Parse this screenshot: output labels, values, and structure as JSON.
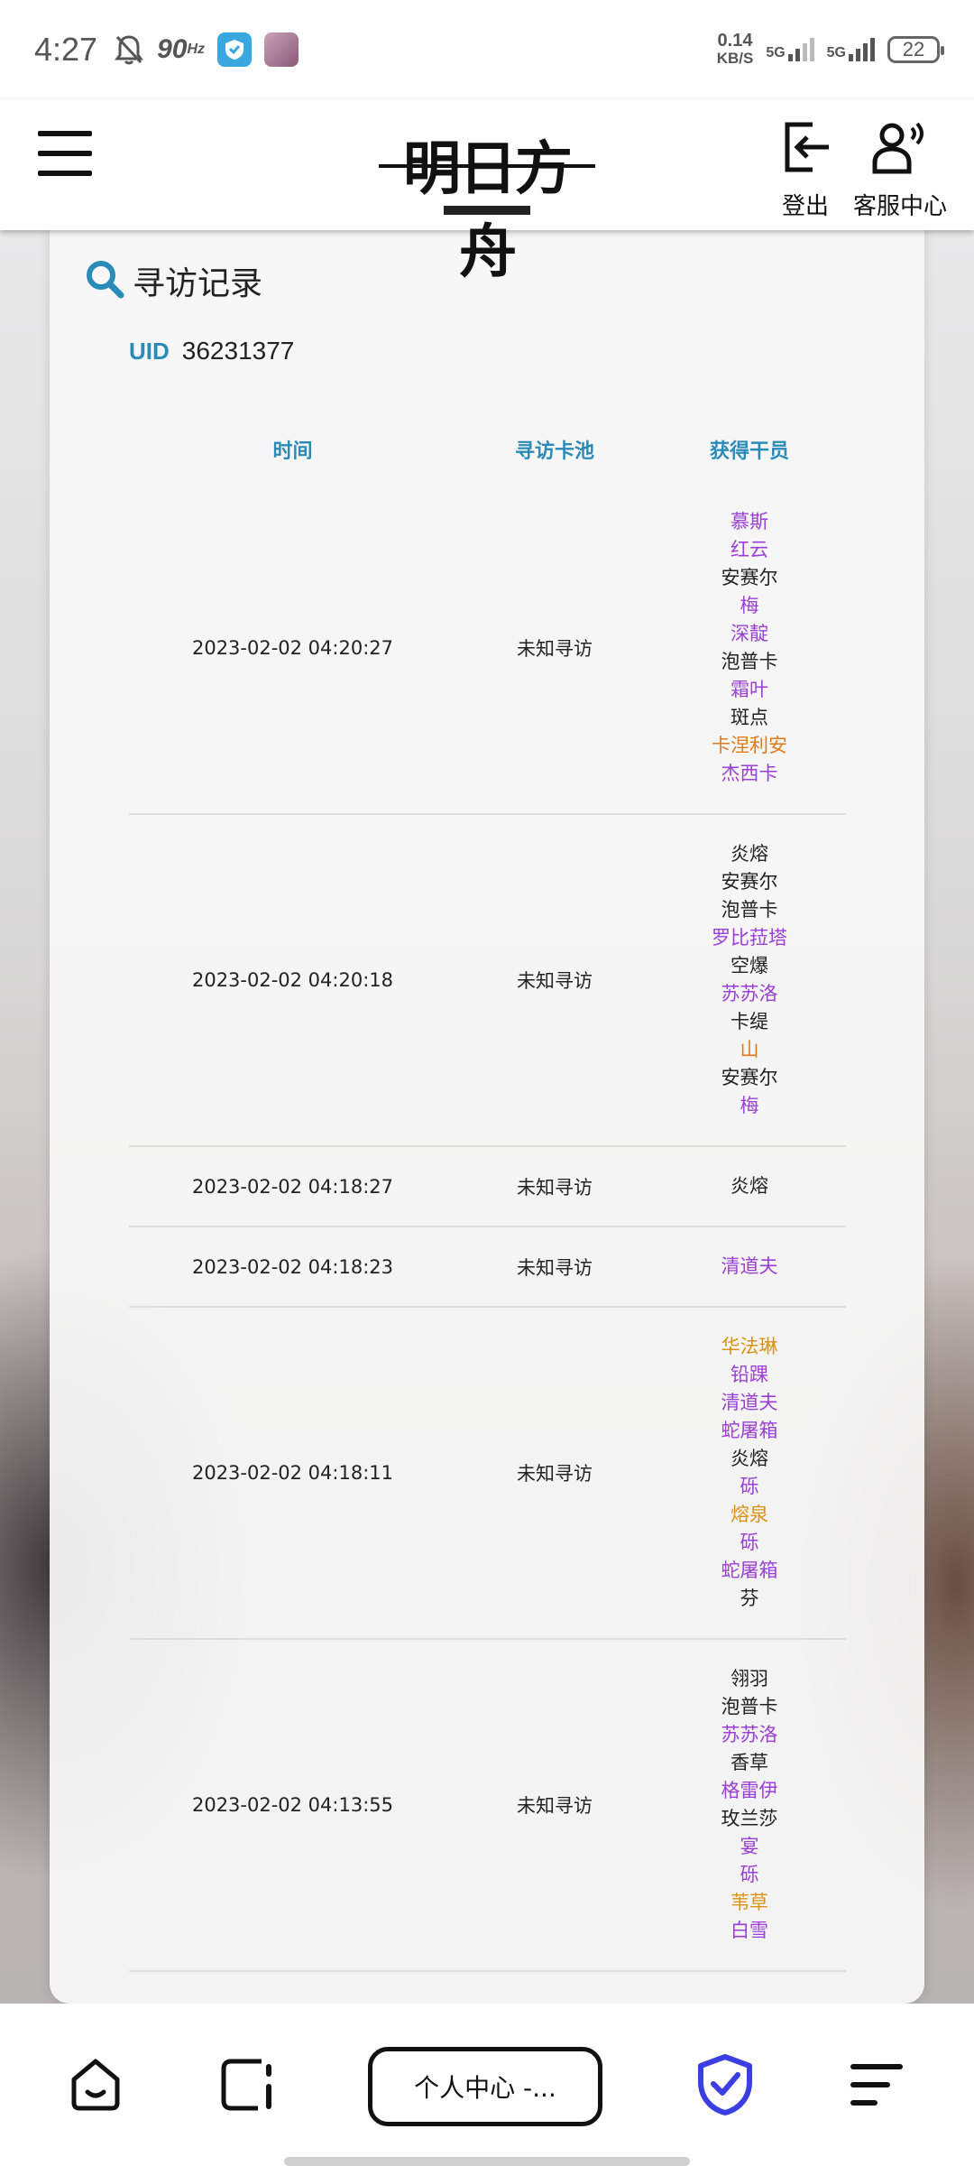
{
  "status_bar": {
    "time": "4:27",
    "refresh_rate": "90",
    "refresh_unit": "Hz",
    "net_speed_value": "0.14",
    "net_speed_unit": "KB/S",
    "signal1_label": "5G",
    "signal2_label": "5G",
    "battery": "22"
  },
  "header": {
    "logo_text": "明日方舟",
    "logout_label": "登出",
    "service_label": "客服中心"
  },
  "card": {
    "title": "寻访记录",
    "uid_label": "UID",
    "uid_value": "36231377"
  },
  "table": {
    "columns": [
      "时间",
      "寻访卡池",
      "获得干员"
    ],
    "rows": [
      {
        "time": "2023-02-02 04:20:27",
        "pool": "未知寻访",
        "operators": [
          {
            "name": "慕斯",
            "color": "#9b3fd6"
          },
          {
            "name": "红云",
            "color": "#9b3fd6"
          },
          {
            "name": "安赛尔",
            "color": "#222222"
          },
          {
            "name": "梅",
            "color": "#9b3fd6"
          },
          {
            "name": "深靛",
            "color": "#9b3fd6"
          },
          {
            "name": "泡普卡",
            "color": "#222222"
          },
          {
            "name": "霜叶",
            "color": "#9b3fd6"
          },
          {
            "name": "斑点",
            "color": "#222222"
          },
          {
            "name": "卡涅利安",
            "color": "#e07b1a"
          },
          {
            "name": "杰西卡",
            "color": "#9b3fd6"
          }
        ]
      },
      {
        "time": "2023-02-02 04:20:18",
        "pool": "未知寻访",
        "operators": [
          {
            "name": "炎熔",
            "color": "#222222"
          },
          {
            "name": "安赛尔",
            "color": "#222222"
          },
          {
            "name": "泡普卡",
            "color": "#222222"
          },
          {
            "name": "罗比菈塔",
            "color": "#9b3fd6"
          },
          {
            "name": "空爆",
            "color": "#222222"
          },
          {
            "name": "苏苏洛",
            "color": "#9b3fd6"
          },
          {
            "name": "卡缇",
            "color": "#222222"
          },
          {
            "name": "山",
            "color": "#e07b1a"
          },
          {
            "name": "安赛尔",
            "color": "#222222"
          },
          {
            "name": "梅",
            "color": "#9b3fd6"
          }
        ]
      },
      {
        "time": "2023-02-02 04:18:27",
        "pool": "未知寻访",
        "operators": [
          {
            "name": "炎熔",
            "color": "#222222"
          }
        ]
      },
      {
        "time": "2023-02-02 04:18:23",
        "pool": "未知寻访",
        "operators": [
          {
            "name": "清道夫",
            "color": "#9b3fd6"
          }
        ]
      },
      {
        "time": "2023-02-02 04:18:11",
        "pool": "未知寻访",
        "operators": [
          {
            "name": "华法琳",
            "color": "#d99215"
          },
          {
            "name": "铅踝",
            "color": "#9b3fd6"
          },
          {
            "name": "清道夫",
            "color": "#9b3fd6"
          },
          {
            "name": "蛇屠箱",
            "color": "#9b3fd6"
          },
          {
            "name": "炎熔",
            "color": "#222222"
          },
          {
            "name": "砾",
            "color": "#9b3fd6"
          },
          {
            "name": "熔泉",
            "color": "#d99215"
          },
          {
            "name": "砾",
            "color": "#9b3fd6"
          },
          {
            "name": "蛇屠箱",
            "color": "#9b3fd6"
          },
          {
            "name": "芬",
            "color": "#222222"
          }
        ]
      },
      {
        "time": "2023-02-02 04:13:55",
        "pool": "未知寻访",
        "operators": [
          {
            "name": "翎羽",
            "color": "#222222"
          },
          {
            "name": "泡普卡",
            "color": "#222222"
          },
          {
            "name": "苏苏洛",
            "color": "#9b3fd6"
          },
          {
            "name": "香草",
            "color": "#222222"
          },
          {
            "name": "格雷伊",
            "color": "#9b3fd6"
          },
          {
            "name": "玫兰莎",
            "color": "#222222"
          },
          {
            "name": "宴",
            "color": "#9b3fd6"
          },
          {
            "name": "砾",
            "color": "#9b3fd6"
          },
          {
            "name": "苇草",
            "color": "#d99215"
          },
          {
            "name": "白雪",
            "color": "#9b3fd6"
          }
        ]
      }
    ]
  },
  "bottom_bar": {
    "tab_label": "个人中心 -...",
    "icons": [
      "home-icon",
      "tabs-icon",
      "shield-check-icon",
      "menu-icon"
    ],
    "shield_color": "#3b3ee0"
  }
}
